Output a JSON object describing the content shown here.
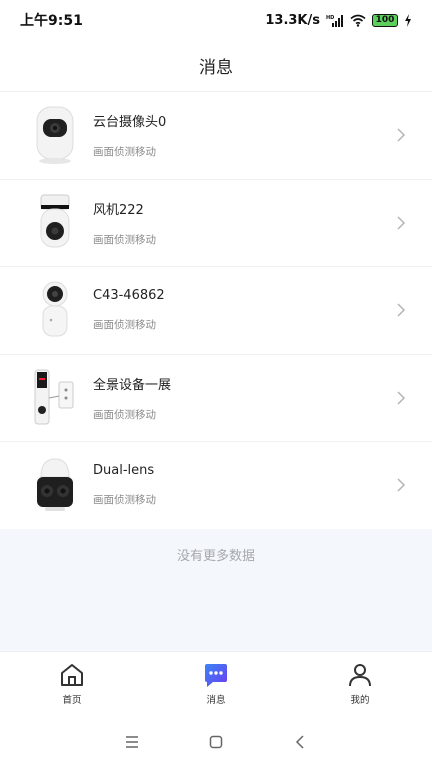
{
  "status_bar": {
    "time": "上午9:51",
    "network_speed": "13.3K/s",
    "battery": "100",
    "icons": [
      "hd-signal-icon",
      "wifi-icon",
      "battery-icon",
      "charging-icon"
    ]
  },
  "header": {
    "title": "消息"
  },
  "messages": [
    {
      "name": "云台摄像头0",
      "subtitle": "画面侦测移动",
      "thumb": "ptz-camera"
    },
    {
      "name": "风机222",
      "subtitle": "画面侦测移动",
      "thumb": "bullet-camera"
    },
    {
      "name": "C43-46862",
      "subtitle": "画面侦测移动",
      "thumb": "dome-camera"
    },
    {
      "name": "全景设备一展",
      "subtitle": "画面侦测移动",
      "thumb": "panoramic-device"
    },
    {
      "name": "Dual-lens",
      "subtitle": "画面侦测移动",
      "thumb": "dual-lens-camera"
    }
  ],
  "footer_text": "没有更多数据",
  "tabbar": {
    "tabs": [
      {
        "label": "首页",
        "icon": "home-icon",
        "active": false
      },
      {
        "label": "消息",
        "icon": "message-icon",
        "active": true
      },
      {
        "label": "我的",
        "icon": "person-icon",
        "active": false
      }
    ]
  },
  "colors": {
    "accent": "#3a6cf0",
    "footer_bg": "#f4f7fb"
  }
}
